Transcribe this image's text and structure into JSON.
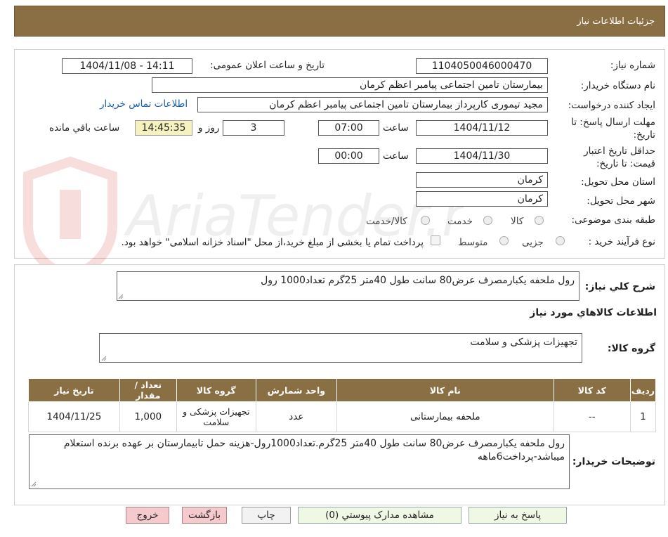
{
  "header": {
    "title": "جزئیات اطلاعات نیاز"
  },
  "form": {
    "need_number_label": "شماره نیاز:",
    "need_number": "1104050046000470",
    "announce_label": "تاریخ و ساعت اعلان عمومی:",
    "announce_value": "1404/11/08 - 14:11",
    "buyer_org_label": "نام دستگاه خریدار:",
    "buyer_org": "بیمارستان تامین اجتماعی پیامبر اعظم کرمان",
    "creator_label": "ایجاد کننده درخواست:",
    "creator": "مجید تیموری کارپرداز بیمارستان تامین اجتماعی پیامبر اعظم کرمان",
    "contact_link": "اطلاعات تماس خریدار",
    "deadline_label_1": "مهلت ارسال پاسخ: تا",
    "deadline_label_2": "تاریخ:",
    "deadline_date": "1404/11/12",
    "time_label": "ساعت",
    "deadline_time": "07:00",
    "days_value": "3",
    "days_label": "روز و",
    "remaining_time": "14:45:35",
    "remaining_label": "ساعت باقي مانده",
    "validity_label_1": "حداقل تاریخ اعتبار",
    "validity_label_2": "قیمت: تا تاریخ:",
    "validity_date": "1404/11/30",
    "validity_time": "00:00",
    "province_label": "استان محل تحویل:",
    "province": "کرمان",
    "city_label": "شهر محل تحویل:",
    "city": "کرمان",
    "category_label": "طبقه بندی موضوعی:",
    "category_options": [
      "کالا",
      "خدمت",
      "کالا/خدمت"
    ],
    "process_label": "نوع فرآیند خرید :",
    "process_options": [
      "جزیی",
      "متوسط"
    ],
    "treasury_note": "پرداخت تمام یا بخشی از مبلغ خرید،از محل \"اسناد خزانه اسلامی\" خواهد بود."
  },
  "summary": {
    "label": "شرح کلي نياز:",
    "text": "رول ملحفه یکبارمصرف عرض80 سانت طول 40متر 25گرم تعداد1000 رول"
  },
  "goods": {
    "section_title": "اطلاعات کالاهاي مورد نياز",
    "group_label": "گروه کالا:",
    "group_value": "تجهیزات پزشکی و سلامت",
    "table_headers": [
      "رديف",
      "کد کالا",
      "نام کالا",
      "واحد شمارش",
      "گروه کالا",
      "تعداد / مقدار",
      "تاریخ نیاز"
    ],
    "rows": [
      [
        "1",
        "--",
        "ملحفه بیمارستانی",
        "عدد",
        "تجهیزات پزشکی و سلامت",
        "1,000",
        "1404/11/25"
      ]
    ]
  },
  "buyer_notes": {
    "label": "توضیحات خریدار:",
    "text": "رول ملحفه یکبارمصرف عرض80 سانت طول 40متر 25گرم.تعداد1000رول-هزینه حمل تابیمارستان بر عهده برنده استعلام میباشد-پرداخت6ماهه"
  },
  "buttons": {
    "reply": "پاسخ به نیاز",
    "attachments": "مشاهده مدارک پیوستي (0)",
    "print": "چاپ",
    "back": "بازگشت",
    "exit": "خروج"
  },
  "watermark_text": "AriaTender.neT"
}
